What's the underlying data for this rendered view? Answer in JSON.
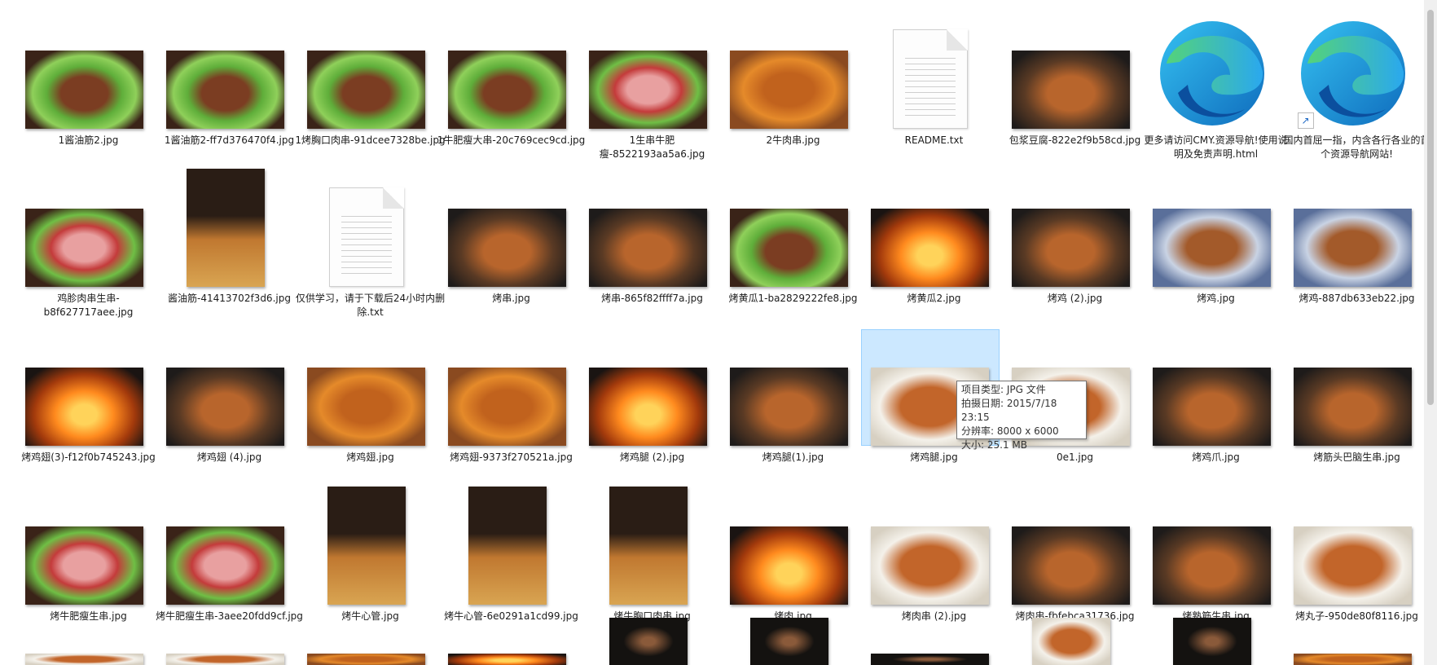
{
  "window": {
    "view_mode": "large-icons"
  },
  "files": [
    {
      "name": "1酱油筋2.jpg",
      "kind": "image",
      "shape": "wide",
      "palette": "green"
    },
    {
      "name": "1酱油筋2-ff7d376470f4.jpg",
      "kind": "image",
      "shape": "wide",
      "palette": "green"
    },
    {
      "name": "1烤胸口肉串-91dcee7328be.jpg",
      "kind": "image",
      "shape": "wide",
      "palette": "green"
    },
    {
      "name": "1牛肥瘦大串-20c769cec9cd.jpg",
      "kind": "image",
      "shape": "wide",
      "palette": "green"
    },
    {
      "name": "1生串牛肥瘦-8522193aa5a6.jpg",
      "kind": "image",
      "shape": "wide",
      "palette": "pink"
    },
    {
      "name": "2牛肉串.jpg",
      "kind": "image",
      "shape": "wide",
      "palette": "orange"
    },
    {
      "name": "README.txt",
      "kind": "text"
    },
    {
      "name": "包浆豆腐-822e2f9b58cd.jpg",
      "kind": "image",
      "shape": "wide",
      "palette": "dark"
    },
    {
      "name": "更多请访问CMY.资源导航!使用说明及免责声明.html",
      "kind": "edge"
    },
    {
      "name": "国内首屈一指，内含各行各业的首个资源导航网站!",
      "kind": "edge-shortcut"
    },
    {
      "name": "鸡胗肉串生串-b8f627717aee.jpg",
      "kind": "image",
      "shape": "wide",
      "palette": "pink"
    },
    {
      "name": "酱油筋-41413702f3d6.jpg",
      "kind": "image",
      "shape": "tall",
      "palette": "hand"
    },
    {
      "name": "仅供学习，请于下载后24小时内删除.txt",
      "kind": "text"
    },
    {
      "name": "烤串.jpg",
      "kind": "image",
      "shape": "wide",
      "palette": "dark"
    },
    {
      "name": "烤串-865f82ffff7a.jpg",
      "kind": "image",
      "shape": "wide",
      "palette": "dark"
    },
    {
      "name": "烤黄瓜1-ba2829222fe8.jpg",
      "kind": "image",
      "shape": "wide",
      "palette": "green"
    },
    {
      "name": "烤黄瓜2.jpg",
      "kind": "image",
      "shape": "wide",
      "palette": "fire"
    },
    {
      "name": "烤鸡 (2).jpg",
      "kind": "image",
      "shape": "wide",
      "palette": "dark"
    },
    {
      "name": "烤鸡.jpg",
      "kind": "image",
      "shape": "wide",
      "palette": "blue"
    },
    {
      "name": "烤鸡-887db633eb22.jpg",
      "kind": "image",
      "shape": "wide",
      "palette": "blue"
    },
    {
      "name": "烤鸡翅(3)-f12f0b745243.jpg",
      "kind": "image",
      "shape": "wide",
      "palette": "fire"
    },
    {
      "name": "烤鸡翅 (4).jpg",
      "kind": "image",
      "shape": "wide",
      "palette": "dark"
    },
    {
      "name": "烤鸡翅.jpg",
      "kind": "image",
      "shape": "wide",
      "palette": "orange"
    },
    {
      "name": "烤鸡翅-9373f270521a.jpg",
      "kind": "image",
      "shape": "wide",
      "palette": "orange"
    },
    {
      "name": "烤鸡腿 (2).jpg",
      "kind": "image",
      "shape": "wide",
      "palette": "fire"
    },
    {
      "name": "烤鸡腿(1).jpg",
      "kind": "image",
      "shape": "wide",
      "palette": "dark"
    },
    {
      "name": "烤鸡腿.jpg",
      "kind": "image",
      "shape": "wide",
      "palette": "white",
      "selected": true
    },
    {
      "name": "0e1.jpg",
      "kind": "image",
      "shape": "wide",
      "palette": "white"
    },
    {
      "name": "烤鸡爪.jpg",
      "kind": "image",
      "shape": "wide",
      "palette": "dark"
    },
    {
      "name": "烤筋头巴脑生串.jpg",
      "kind": "image",
      "shape": "wide",
      "palette": "dark"
    },
    {
      "name": "烤牛肥瘦生串.jpg",
      "kind": "image",
      "shape": "wide",
      "palette": "pink"
    },
    {
      "name": "烤牛肥瘦生串-3aee20fdd9cf.jpg",
      "kind": "image",
      "shape": "wide",
      "palette": "pink"
    },
    {
      "name": "烤牛心管.jpg",
      "kind": "image",
      "shape": "tall",
      "palette": "hand"
    },
    {
      "name": "烤牛心管-6e0291a1cd99.jpg",
      "kind": "image",
      "shape": "tall",
      "palette": "hand"
    },
    {
      "name": "烤牛胸口肉串.jpg",
      "kind": "image",
      "shape": "tall",
      "palette": "hand"
    },
    {
      "name": "烤肉.jpg",
      "kind": "image",
      "shape": "wide",
      "palette": "fire"
    },
    {
      "name": "烤肉串 (2).jpg",
      "kind": "image",
      "shape": "wide",
      "palette": "white"
    },
    {
      "name": "烤肉串-fbfebca31736.jpg",
      "kind": "image",
      "shape": "wide",
      "palette": "dark"
    },
    {
      "name": "烤熟筋生串.jpg",
      "kind": "image",
      "shape": "wide",
      "palette": "dark"
    },
    {
      "name": "烤丸子-950de80f8116.jpg",
      "kind": "image",
      "shape": "wide",
      "palette": "white"
    },
    {
      "name": "",
      "kind": "image",
      "shape": "cut",
      "palette": "white"
    },
    {
      "name": "",
      "kind": "image",
      "shape": "cut",
      "palette": "white"
    },
    {
      "name": "",
      "kind": "image",
      "shape": "cut",
      "palette": "orange"
    },
    {
      "name": "",
      "kind": "image",
      "shape": "cut",
      "palette": "fire"
    },
    {
      "name": "",
      "kind": "image",
      "shape": "cuttall",
      "palette": "black"
    },
    {
      "name": "",
      "kind": "image",
      "shape": "cuttall",
      "palette": "black"
    },
    {
      "name": "",
      "kind": "image",
      "shape": "cut",
      "palette": "black"
    },
    {
      "name": "",
      "kind": "image",
      "shape": "cuttall",
      "palette": "white"
    },
    {
      "name": "",
      "kind": "image",
      "shape": "cuttall",
      "palette": "black"
    },
    {
      "name": "",
      "kind": "image",
      "shape": "cut",
      "palette": "orange"
    }
  ],
  "tooltip": {
    "type": "项目类型: JPG 文件",
    "date": "拍摄日期: 2015/7/18 23:15",
    "resolution": "分辨率: 8000 x 6000",
    "size": "大小: 25.1 MB"
  }
}
